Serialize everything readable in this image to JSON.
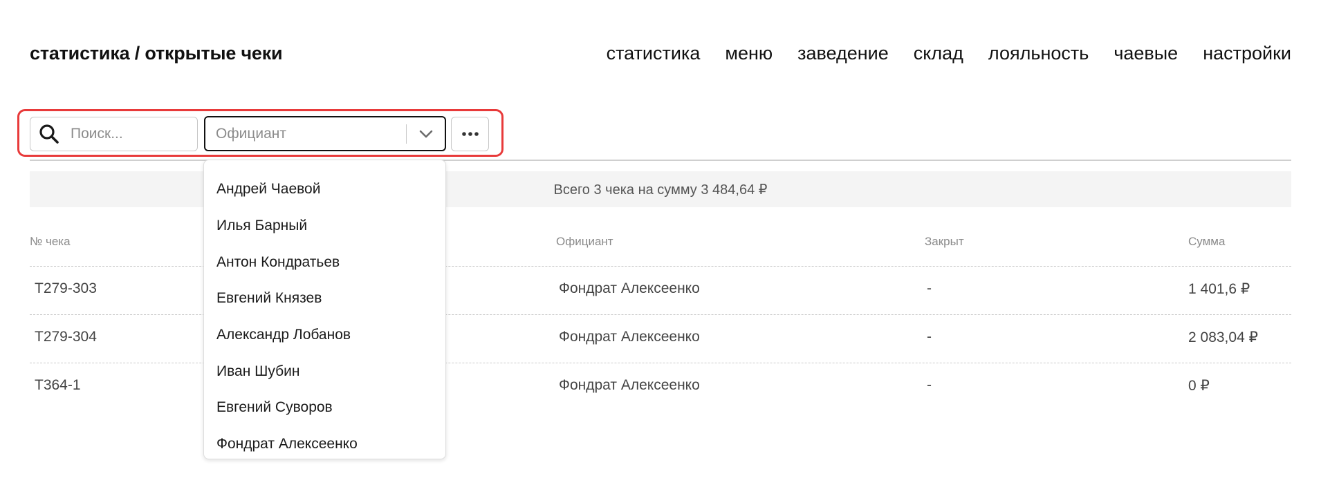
{
  "header": {
    "title": "статистика / открытые чеки",
    "nav": [
      "статистика",
      "меню",
      "заведение",
      "склад",
      "лояльность",
      "чаевые",
      "настройки"
    ]
  },
  "filters": {
    "search_placeholder": "Поиск...",
    "waiter_placeholder": "Официант",
    "more_label": "•••"
  },
  "summary": "Всего 3 чека на сумму 3 484,64 ₽",
  "table": {
    "columns": [
      "№ чека",
      "Официант",
      "Закрыт",
      "Сумма"
    ],
    "rows": [
      {
        "number": "T279-303",
        "waiter": "Фондрат Алексеенко",
        "closed": "-",
        "sum": "1 401,6 ₽"
      },
      {
        "number": "T279-304",
        "waiter": "Фондрат Алексеенко",
        "closed": "-",
        "sum": "2 083,04 ₽"
      },
      {
        "number": "T364-1",
        "waiter": "Фондрат Алексеенко",
        "closed": "-",
        "sum": "0 ₽"
      }
    ]
  },
  "dropdown": {
    "options": [
      "Андрей Чаевой",
      "Илья Барный",
      "Антон Кондратьев",
      "Евгений Князев",
      "Александр Лобанов",
      "Иван Шубин",
      "Евгений Суворов",
      "Фондрат Алексеенко"
    ]
  },
  "colors": {
    "highlight": "#e83a3a",
    "summary_bg": "#f4f4f4",
    "text": "#1a1a1a",
    "muted": "#8a8a8a"
  },
  "icons": {
    "search": "search-icon",
    "chevron": "chevron-down-icon",
    "more": "more-dots-icon"
  }
}
